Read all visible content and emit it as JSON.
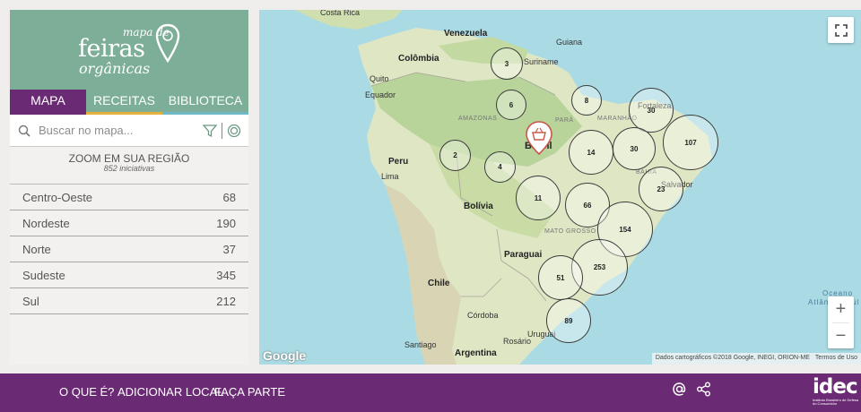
{
  "logo": {
    "line1": "mapa de",
    "line2": "feiras",
    "line3": "orgânicas"
  },
  "tabs": [
    {
      "label": "MAPA"
    },
    {
      "label": "RECEITAS"
    },
    {
      "label": "BIBLIOTECA"
    }
  ],
  "search": {
    "placeholder": "Buscar no mapa..."
  },
  "zoom_notice": {
    "title": "ZOOM EM SUA REGIÃO",
    "subtitle": "852 iniciativas"
  },
  "regions": [
    {
      "name": "Centro-Oeste",
      "count": "68"
    },
    {
      "name": "Nordeste",
      "count": "190"
    },
    {
      "name": "Norte",
      "count": "37"
    },
    {
      "name": "Sudeste",
      "count": "345"
    },
    {
      "name": "Sul",
      "count": "212"
    }
  ],
  "map": {
    "labels": {
      "costa_rica": "Costa Rica",
      "venezuela": "Venezuela",
      "guiana": "Guiana",
      "colombia": "Colômbia",
      "suriname": "Suriname",
      "quito": "Quito",
      "equador": "Equador",
      "amazonas": "AMAZONAS",
      "para": "PARÁ",
      "maranhao": "MARANHÃO",
      "brasil": "Brasil",
      "peru": "Peru",
      "lima": "Lima",
      "bolivia": "Bolívia",
      "mato_grosso": "MATO GROSSO",
      "paraguai": "Paraguai",
      "chile": "Chile",
      "cordoba": "Córdoba",
      "santiago": "Santiago",
      "rosario": "Rosário",
      "uruguai": "Uruguai",
      "argentina": "Argentina",
      "oceano": "Oceano",
      "atlantico_sul": "Atlântico Sul",
      "fortaleza": "Fortaleza",
      "salvador": "Salvador",
      "bahia": "BAHIA"
    },
    "clusters": [
      {
        "count": "3"
      },
      {
        "count": "6"
      },
      {
        "count": "8"
      },
      {
        "count": "30"
      },
      {
        "count": "107"
      },
      {
        "count": "2"
      },
      {
        "count": "4"
      },
      {
        "count": "14"
      },
      {
        "count": "30"
      },
      {
        "count": "23"
      },
      {
        "count": "11"
      },
      {
        "count": "66"
      },
      {
        "count": "154"
      },
      {
        "count": "253"
      },
      {
        "count": "51"
      },
      {
        "count": "89"
      }
    ],
    "google": "Google",
    "attribution": "Dados cartográficos ©2018 Google, INEGI, ORION-ME",
    "terms": "Termos de Uso",
    "zoom_in": "+",
    "zoom_out": "−"
  },
  "footer": {
    "links": [
      {
        "label": "O QUE É?"
      },
      {
        "label": "ADICIONAR LOCAL"
      },
      {
        "label": "FAÇA PARTE"
      }
    ],
    "brand": "idec",
    "brand_sub": "Instituto Brasileiro de Defesa do Consumidor"
  },
  "colors": {
    "purple": "#6b2b74",
    "green": "#7dae98",
    "yellow": "#e4b23c",
    "teal": "#6fb8c6"
  }
}
